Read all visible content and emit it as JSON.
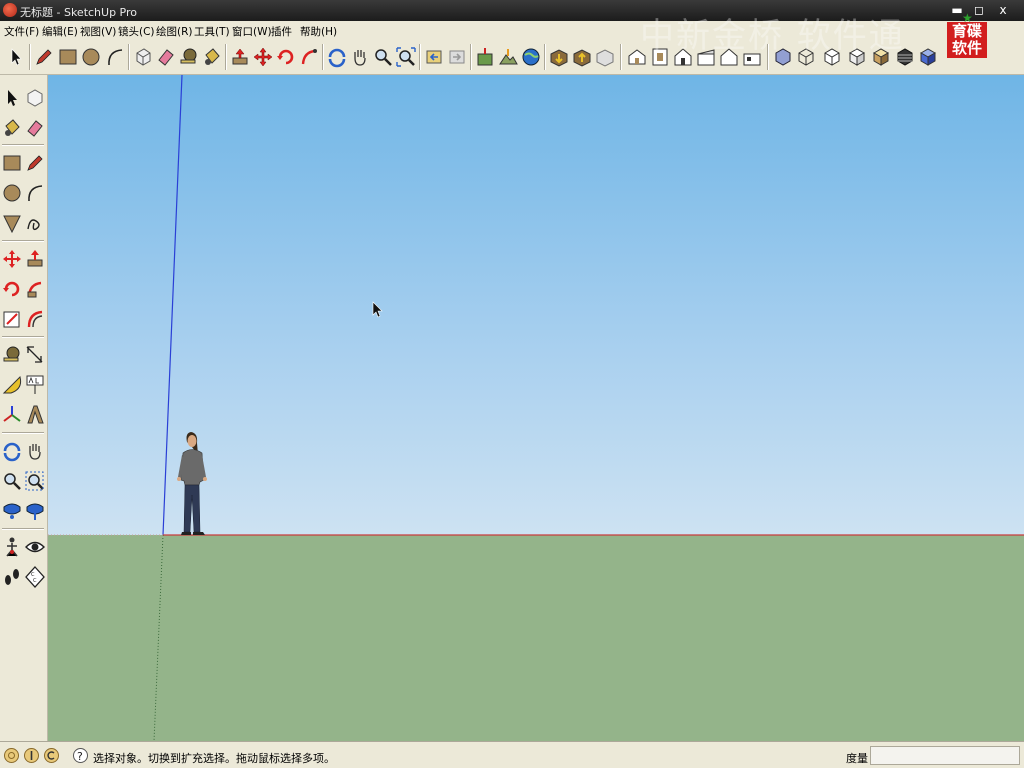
{
  "window": {
    "title": "无标题 - SketchUp Pro",
    "min_glyph": "▬",
    "max_glyph": "◻",
    "close_glyph": "x"
  },
  "menu": [
    {
      "label": "文件(F)"
    },
    {
      "label": "编辑(E)"
    },
    {
      "label": "视图(V)"
    },
    {
      "label": "镜头(C)"
    },
    {
      "label": "绘图(R)"
    },
    {
      "label": "工具(T)"
    },
    {
      "label": "窗口(W)"
    },
    {
      "label": "插件"
    },
    {
      "label": "帮助(H)"
    }
  ],
  "toolbar_icons": [
    "select-icon",
    "pencil-icon",
    "rectangle-icon",
    "circle-icon",
    "arc-icon",
    "make-component-icon",
    "eraser-icon",
    "tape-measure-icon",
    "paint-bucket-icon",
    "push-pull-icon",
    "move-icon",
    "rotate-icon",
    "follow-me-icon",
    "orbit-icon",
    "pan-icon",
    "zoom-icon",
    "zoom-extents-icon",
    "previous-view-icon",
    "next-view-icon",
    "add-location-icon",
    "toggle-terrain-icon",
    "preview-in-google-earth-icon",
    "get-models-icon",
    "share-model-icon",
    "share-component-icon",
    "iso-view-icon",
    "top-view-icon",
    "front-view-icon",
    "right-view-icon",
    "back-view-icon",
    "left-view-icon",
    "xray-icon",
    "wireframe-icon",
    "hidden-line-icon",
    "shaded-icon",
    "shaded-textures-icon",
    "monochrome-icon"
  ],
  "left_icons": [
    "select-icon",
    "make-component-icon",
    "paint-bucket-icon",
    "eraser-icon",
    "rectangle-icon",
    "line-icon",
    "circle-icon",
    "arc-icon",
    "polygon-icon",
    "freehand-icon",
    "move-icon",
    "push-pull-icon",
    "rotate-icon",
    "follow-me-icon",
    "scale-icon",
    "offset-icon",
    "tape-measure-icon",
    "dimension-icon",
    "protractor-icon",
    "text-icon",
    "axes-icon",
    "3d-text-icon",
    "orbit-icon",
    "pan-icon",
    "zoom-icon",
    "zoom-window-icon",
    "zoom-extents-icon",
    "previous-icon",
    "position-camera-icon",
    "look-around-icon",
    "walk-icon",
    "section-plane-icon"
  ],
  "watermark": {
    "text": "中新金桥 软件通"
  },
  "logo": {
    "line1": "育碟",
    "line2": "软件"
  },
  "status": {
    "text": "选择对象。切换到扩充选择。拖动鼠标选择多项。",
    "measure_label": "度量",
    "measure_value": ""
  },
  "colors": {
    "sky_top": "#6fb5e6",
    "ground": "#94b48a",
    "red_axis": "#c83c3c",
    "blue_axis": "#2a3fd6",
    "green_axis": "#3c8c3c"
  }
}
